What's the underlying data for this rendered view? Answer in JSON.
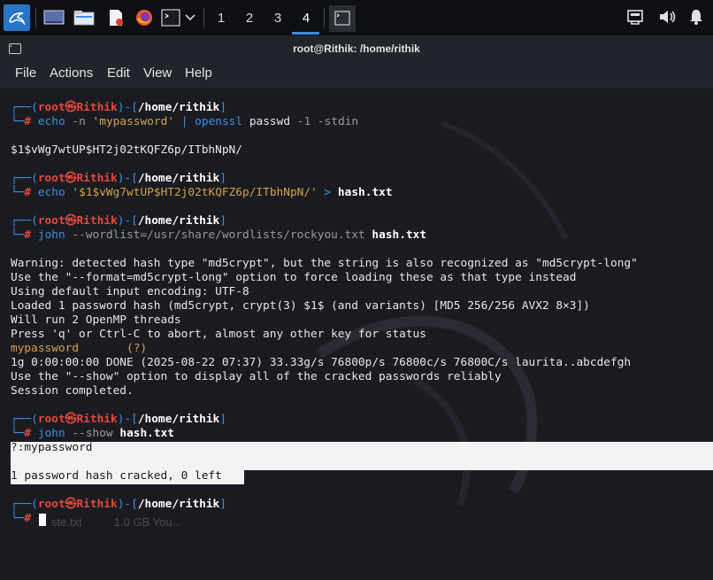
{
  "panel": {
    "workspaces": [
      "1",
      "2",
      "3",
      "4"
    ],
    "active_workspace": "4",
    "accent_color": "#3c8ce4"
  },
  "window": {
    "title": "root@Rithik: /home/rithik",
    "menu": [
      "File",
      "Actions",
      "Edit",
      "View",
      "Help"
    ]
  },
  "terminal": {
    "prompt_user": "root",
    "prompt_at": "㉿",
    "prompt_host": "Rithik",
    "prompt_path": "/home/rithik",
    "block1": {
      "c1": "echo",
      "c2": "-n",
      "c3": "'mypassword'",
      "c4": "|",
      "c5": "openssl",
      "c6": "passwd",
      "c7": "-1",
      "c8": "-stdin",
      "output": "$1$vWg7wtUP$HT2j02tKQFZ6p/ITbhNpN/"
    },
    "block2": {
      "c1": "echo",
      "c2": "'$1$vWg7wtUP$HT2j02tKQFZ6p/ITbhNpN/'",
      "c3": ">",
      "c4": "hash.txt"
    },
    "block3": {
      "c1": "john",
      "c2": "--wordlist=/usr/share/wordlists/rockyou.txt",
      "c3": "hash.txt",
      "lines": [
        "Warning: detected hash type \"md5crypt\", but the string is also recognized as \"md5crypt-long\"",
        "Use the \"--format=md5crypt-long\" option to force loading these as that type instead",
        "Using default input encoding: UTF-8",
        "Loaded 1 password hash (md5crypt, crypt(3) $1$ (and variants) [MD5 256/256 AVX2 8×3])",
        "Will run 2 OpenMP threads",
        "Press 'q' or Ctrl-C to abort, almost any other key for status"
      ],
      "cracked_word": "mypassword",
      "cracked_tag": "(?)",
      "lines2": [
        "1g 0:00:00:00 DONE (2025-08-22 07:37) 33.33g/s 76800p/s 76800c/s 76800C/s laurita..abcdefgh",
        "Use the \"--show\" option to display all of the cracked passwords reliably",
        "Session completed."
      ]
    },
    "block4": {
      "c1": "john",
      "c2": "--show",
      "c3": "hash.txt",
      "out1": "?:mypassword",
      "out2": "1 password hash cracked, 0 left"
    },
    "background_hint": "ste.txt          1.0 GB You..."
  }
}
